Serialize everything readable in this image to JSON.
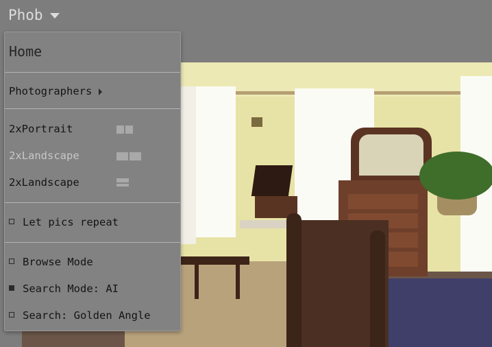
{
  "brand": {
    "label": "Phob"
  },
  "menu": {
    "home": "Home",
    "photographers": "Photographers",
    "layouts": [
      {
        "label": "2xPortrait",
        "enabled": true
      },
      {
        "label": "2xLandscape",
        "enabled": false
      },
      {
        "label": "2xLandscape",
        "enabled": true
      }
    ],
    "repeat": {
      "label": "Let pics repeat",
      "checked": false
    },
    "modes": [
      {
        "label": "Browse Mode",
        "checked": false
      },
      {
        "label": "Search Mode: AI",
        "checked": true
      },
      {
        "label": "Search: Golden Angle",
        "checked": false
      }
    ]
  },
  "colors": {
    "background": "#7d7d7d",
    "menu_bg": "#828282",
    "text": "#141414",
    "disabled_text": "#c8c8c8"
  }
}
